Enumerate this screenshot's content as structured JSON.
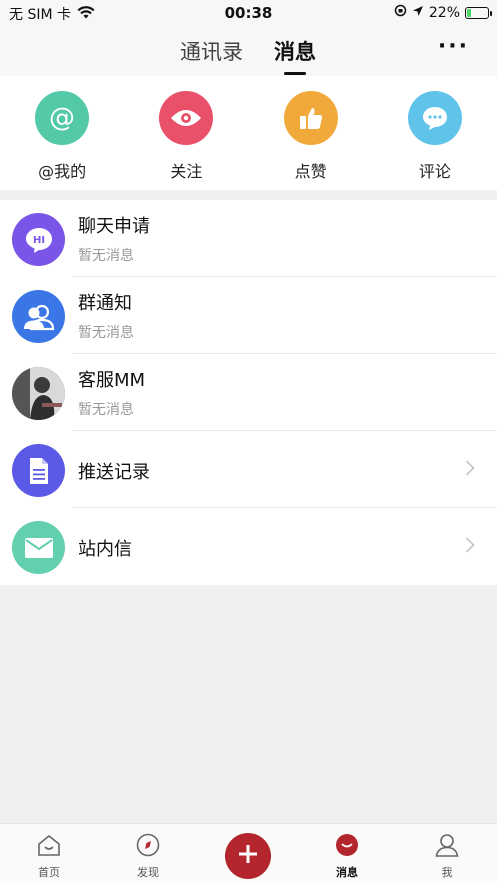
{
  "status_bar": {
    "carrier": "无 SIM 卡",
    "time": "00:38",
    "battery": "22%",
    "battery_level": 0.22
  },
  "header": {
    "tabs": [
      {
        "label": "通讯录",
        "active": false
      },
      {
        "label": "消息",
        "active": true
      }
    ],
    "more_label": "···"
  },
  "quick_actions": [
    {
      "label": "@我的",
      "icon": "at-icon",
      "color": "#54c9a8"
    },
    {
      "label": "关注",
      "icon": "eye-icon",
      "color": "#e9506a"
    },
    {
      "label": "点赞",
      "icon": "thumbs-up-icon",
      "color": "#f0a93a"
    },
    {
      "label": "评论",
      "icon": "chat-bubble-icon",
      "color": "#5fc3ea"
    }
  ],
  "list": [
    {
      "title": "聊天申请",
      "subtitle": "暂无消息",
      "icon": "hi-chat-icon",
      "color": "#7b55e8"
    },
    {
      "title": "群通知",
      "subtitle": "暂无消息",
      "icon": "group-icon",
      "color": "#3a76e6"
    },
    {
      "title": "客服MM",
      "subtitle": "暂无消息",
      "icon": "customer-service-avatar"
    },
    {
      "title": "推送记录",
      "icon": "document-icon",
      "color": "#5a5ae6"
    },
    {
      "title": "站内信",
      "icon": "envelope-icon",
      "color": "#62cfae"
    }
  ],
  "bottom_nav": {
    "items": [
      {
        "label": "首页",
        "icon": "home-icon"
      },
      {
        "label": "发现",
        "icon": "discover-icon"
      },
      {
        "label": "",
        "icon": "add-icon",
        "color": "#b3262d"
      },
      {
        "label": "消息",
        "icon": "message-icon",
        "active": true
      },
      {
        "label": "我",
        "icon": "profile-icon"
      }
    ]
  }
}
